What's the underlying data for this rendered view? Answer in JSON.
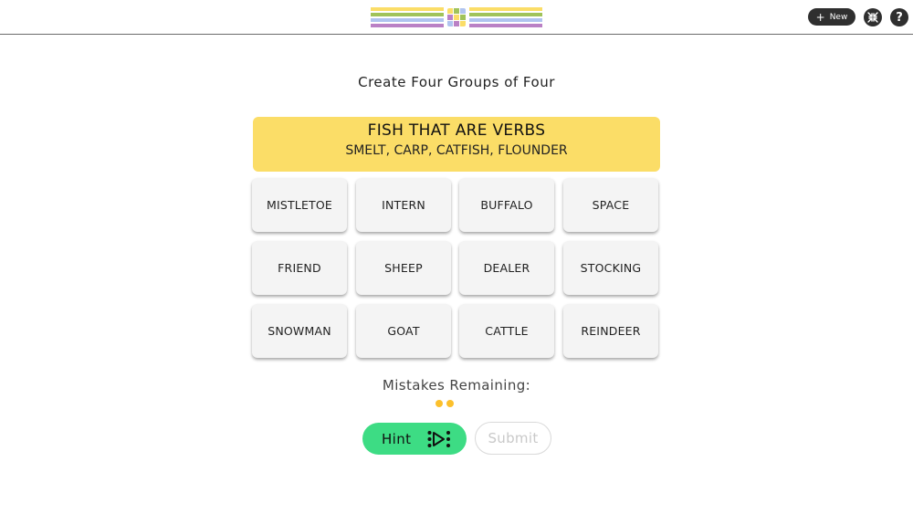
{
  "header": {
    "new_label": "New",
    "help_label": "?",
    "icons": {
      "new": "plus-icon",
      "collapse": "collapse-arrows-icon",
      "logo": "color-grid-logo"
    },
    "logo_colors": [
      "#fbdd67",
      "#a0c35a",
      "#b0c4ef",
      "#ba81c5"
    ],
    "logo_grid_colors": [
      "#fbdd67",
      "#a0c35a",
      "#b0c4ef",
      "#ba81c5",
      "#fbdd67",
      "#a0c35a",
      "#b0c4ef",
      "#ba81c5",
      "#fbdd67"
    ]
  },
  "game": {
    "title": "Create Four Groups of Four",
    "solved_groups": [
      {
        "category": "FISH THAT ARE VERBS",
        "words": "SMELT, CARP, CATFISH, FLOUNDER",
        "color": "#fbdd67"
      }
    ],
    "tiles": [
      [
        "MISTLETOE",
        "INTERN",
        "BUFFALO",
        "SPACE"
      ],
      [
        "FRIEND",
        "SHEEP",
        "DEALER",
        "STOCKING"
      ],
      [
        "SNOWMAN",
        "GOAT",
        "CATTLE",
        "REINDEER"
      ]
    ],
    "mistakes_label": "Mistakes Remaining:",
    "mistakes_remaining": 2,
    "hint_label": "Hint",
    "submit_label": "Submit",
    "colors": {
      "hint": "#3ddc84",
      "dot": "#fcc02c",
      "solved": "#fbdd67"
    }
  }
}
